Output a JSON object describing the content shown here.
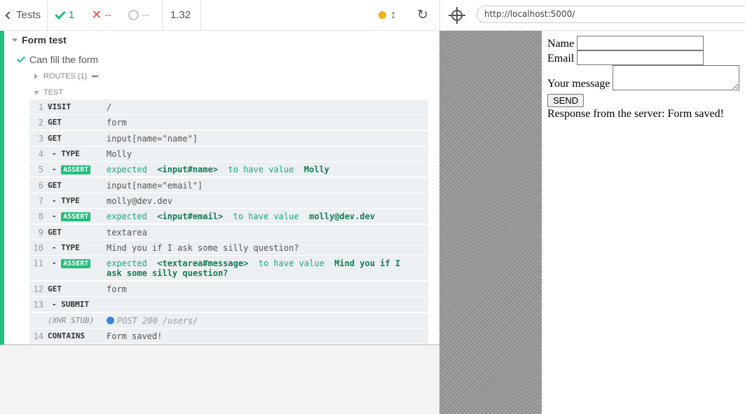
{
  "reporter": {
    "back_label": "Tests",
    "stats": {
      "passed": "1",
      "failed": "--",
      "pending": "--"
    },
    "duration": "1.32",
    "suite_title": "Form test",
    "test_title": "Can fill the form",
    "routes_label": "ROUTES (1)",
    "routes_more": "•••",
    "test_label": "TEST",
    "commands": [
      {
        "num": "1",
        "name": "VISIT",
        "msg": "/"
      },
      {
        "num": "2",
        "name": "GET",
        "msg": "form"
      },
      {
        "num": "3",
        "name": "GET",
        "msg": "input[name=\"name\"]"
      },
      {
        "num": "4",
        "name": "- TYPE",
        "msg": "Molly"
      },
      {
        "num": "5",
        "name": "- ",
        "badge": "ASSERT",
        "expected": "expected",
        "subject": "<input#name>",
        "verb": "to have value",
        "value": "Molly"
      },
      {
        "num": "6",
        "name": "GET",
        "msg": "input[name=\"email\"]"
      },
      {
        "num": "7",
        "name": "- TYPE",
        "msg": "molly@dev.dev"
      },
      {
        "num": "8",
        "name": "- ",
        "badge": "ASSERT",
        "expected": "expected",
        "subject": "<input#email>",
        "verb": "to have value",
        "value": "molly@dev.dev"
      },
      {
        "num": "9",
        "name": "GET",
        "msg": "textarea"
      },
      {
        "num": "10",
        "name": "- TYPE",
        "msg": "Mind you if I ask some silly question?"
      },
      {
        "num": "11",
        "name": "- ",
        "badge": "ASSERT",
        "expected": "expected",
        "subject": "<textarea#message>",
        "verb": "to have value",
        "value": "Mind you if I ask some silly question?"
      },
      {
        "num": "12",
        "name": "GET",
        "msg": "form"
      },
      {
        "num": "13",
        "name": "- SUBMIT",
        "msg": ""
      },
      {
        "num": "",
        "name": "(XHR STUB)",
        "msg": "POST 200 /users/"
      },
      {
        "num": "14",
        "name": "CONTAINS",
        "msg": "Form saved!"
      }
    ]
  },
  "aut": {
    "url": "http://localhost:5000/",
    "form": {
      "name_label": "Name",
      "email_label": "Email",
      "message_label": "Your message",
      "send_label": "SEND",
      "response_text": "Response from the server: Form saved!"
    }
  },
  "colors": {
    "passed": "#1fbf7c",
    "failed": "#e34c4c",
    "xhr_dot": "#3d88d8",
    "pending_dot": "#f1b21f"
  }
}
